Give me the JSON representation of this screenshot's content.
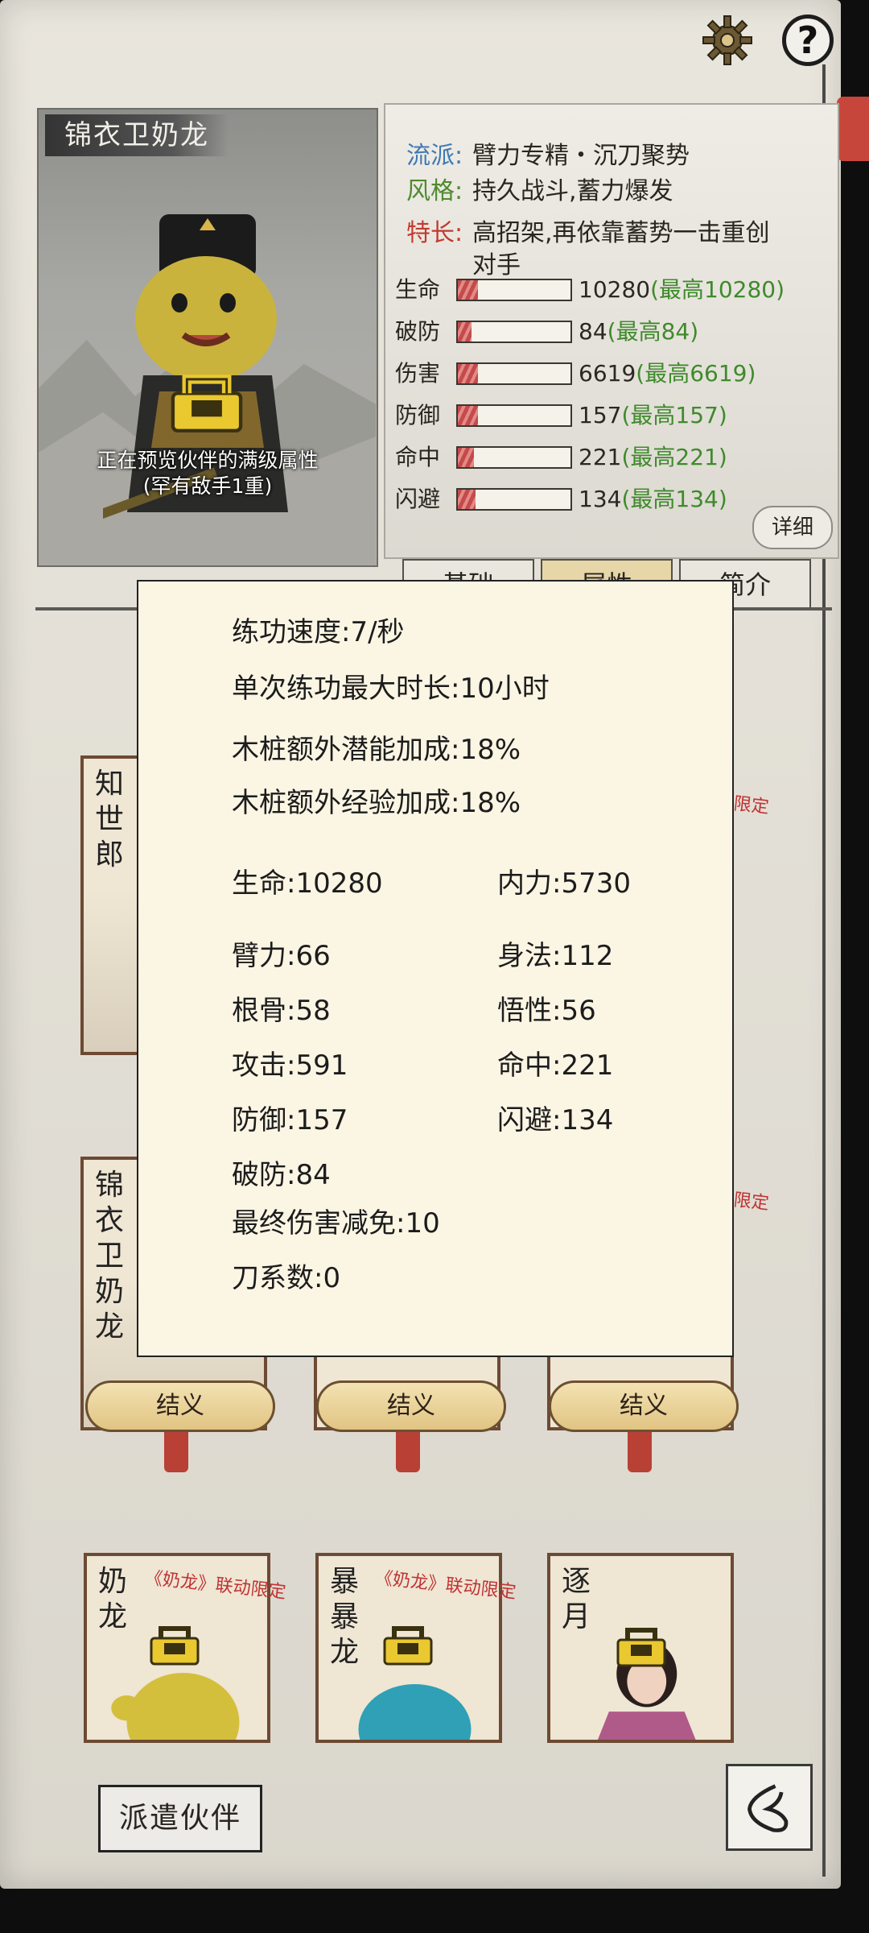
{
  "header": {
    "gear_icon": "gear-icon",
    "help_symbol": "?"
  },
  "partner": {
    "name": "锦衣卫奶龙",
    "preview_line1": "正在预览伙伴的满级属性",
    "preview_line2": "(罕有敌手1重)"
  },
  "traits": [
    {
      "key": "流派:",
      "value": "臂力专精・沉刀聚势",
      "color": "#3f79b4"
    },
    {
      "key": "风格:",
      "value": "持久战斗,蓄力爆发",
      "color": "#4f8a2f"
    },
    {
      "key": "特长:",
      "value": "高招架,再依靠蓄势一击重创",
      "value2": "对手",
      "color": "#c23b2e"
    }
  ],
  "stats": [
    {
      "label": "生命",
      "value": "10280",
      "max": "(最高10280)",
      "fill": 0.18
    },
    {
      "label": "破防",
      "value": "84",
      "max": "(最高84)",
      "fill": 0.12
    },
    {
      "label": "伤害",
      "value": "6619",
      "max": "(最高6619)",
      "fill": 0.18
    },
    {
      "label": "防御",
      "value": "157",
      "max": "(最高157)",
      "fill": 0.18
    },
    {
      "label": "命中",
      "value": "221",
      "max": "(最高221)",
      "fill": 0.14
    },
    {
      "label": "闪避",
      "value": "134",
      "max": "(最高134)",
      "fill": 0.16
    }
  ],
  "detail_button": "详细",
  "tabs": [
    "基础",
    "属性",
    "简介"
  ],
  "cards": {
    "row1_name": "知世郎",
    "row1_collab": "限定",
    "row2_name": "锦衣卫奶龙",
    "row2_collab": "限定",
    "oath_labels": [
      "结义",
      "结义",
      "结义"
    ],
    "row3": [
      {
        "name": "奶龙",
        "collab": "《奶龙》联动限定"
      },
      {
        "name": "暴暴龙",
        "collab": "《奶龙》联动限定"
      },
      {
        "name": "逐月",
        "collab": ""
      }
    ]
  },
  "dispatch_button": "派遣伙伴",
  "popup": {
    "line1": "练功速度:7/秒",
    "line2": "单次练功最大时长:10小时",
    "line3": "木桩额外潜能加成:18%",
    "line4": "木桩额外经验加成:18%",
    "left": [
      "生命:10280",
      "臂力:66",
      "根骨:58",
      "攻击:591",
      "防御:157",
      "破防:84",
      "最终伤害减免:10",
      "刀系数:0"
    ],
    "right": [
      "内力:5730",
      "身法:112",
      "悟性:56",
      "命中:221",
      "闪避:134"
    ]
  }
}
